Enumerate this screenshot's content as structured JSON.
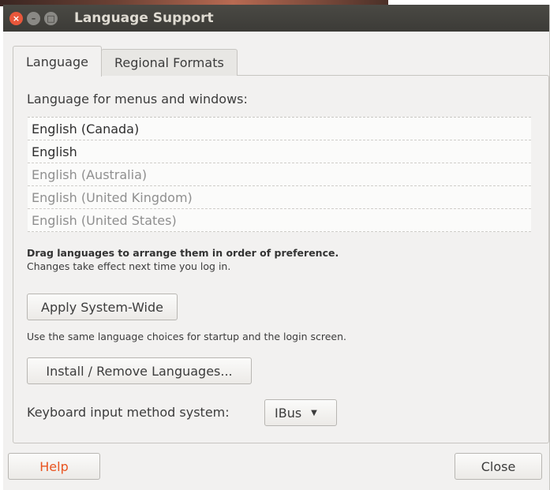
{
  "window": {
    "title": "Language Support",
    "controls": {
      "close": "×",
      "minimize": "–",
      "maximize": "□"
    }
  },
  "tabs": [
    {
      "label": "Language",
      "active": true
    },
    {
      "label": "Regional Formats",
      "active": false
    }
  ],
  "language_page": {
    "section_label": "Language for menus and windows:",
    "languages": [
      {
        "label": "English (Canada)",
        "style": "primary"
      },
      {
        "label": "English",
        "style": "primary"
      },
      {
        "label": "English (Australia)",
        "style": "secondary"
      },
      {
        "label": "English (United Kingdom)",
        "style": "secondary"
      },
      {
        "label": "English (United States)",
        "style": "secondary"
      }
    ],
    "drag_hint": "Drag languages to arrange them in order of preference.",
    "effect_hint": "Changes take effect next time you log in.",
    "apply_button": "Apply System-Wide",
    "apply_hint": "Use the same language choices for startup and the login screen.",
    "install_button": "Install / Remove Languages...",
    "keyboard_label": "Keyboard input method system:",
    "keyboard_value": "IBus"
  },
  "footer": {
    "help_button": "Help",
    "close_button": "Close"
  },
  "colors": {
    "titlebar": "#3c3b37",
    "close_control": "#e9573b",
    "help_text": "#e95420"
  },
  "icons": {
    "dropdown": "triangle-down-icon"
  }
}
